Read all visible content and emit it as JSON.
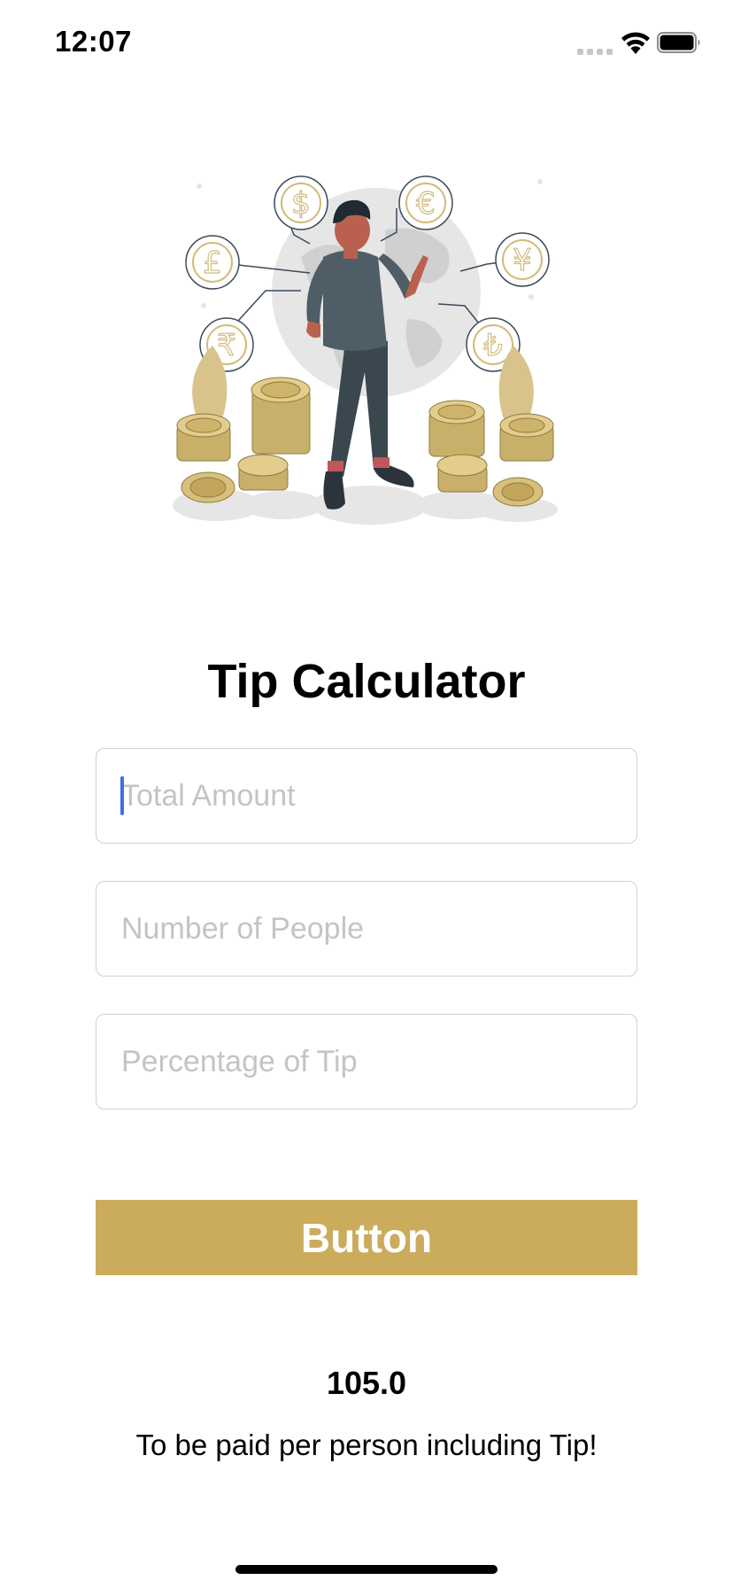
{
  "status_bar": {
    "time": "12:07",
    "icons": [
      "cellular-signal-icon",
      "wifi-icon",
      "battery-icon"
    ]
  },
  "hero": {
    "icon": "currency-exchange-illustration",
    "coin_symbols": [
      "$",
      "€",
      "£",
      "¥",
      "₹",
      "₺"
    ]
  },
  "title": "Tip Calculator",
  "inputs": {
    "total_amount": {
      "placeholder": "Total Amount",
      "value": ""
    },
    "number_of_people": {
      "placeholder": "Number of People",
      "value": ""
    },
    "percentage_of_tip": {
      "placeholder": "Percentage of Tip",
      "value": ""
    }
  },
  "button": {
    "label": "Button"
  },
  "result": {
    "value": "105.0",
    "caption": "To be paid per person including Tip!"
  },
  "colors": {
    "accent": "#cbab5c",
    "placeholder": "#c4c4c7",
    "caret": "#3f6fe0",
    "field_border": "#d0d0d4"
  }
}
